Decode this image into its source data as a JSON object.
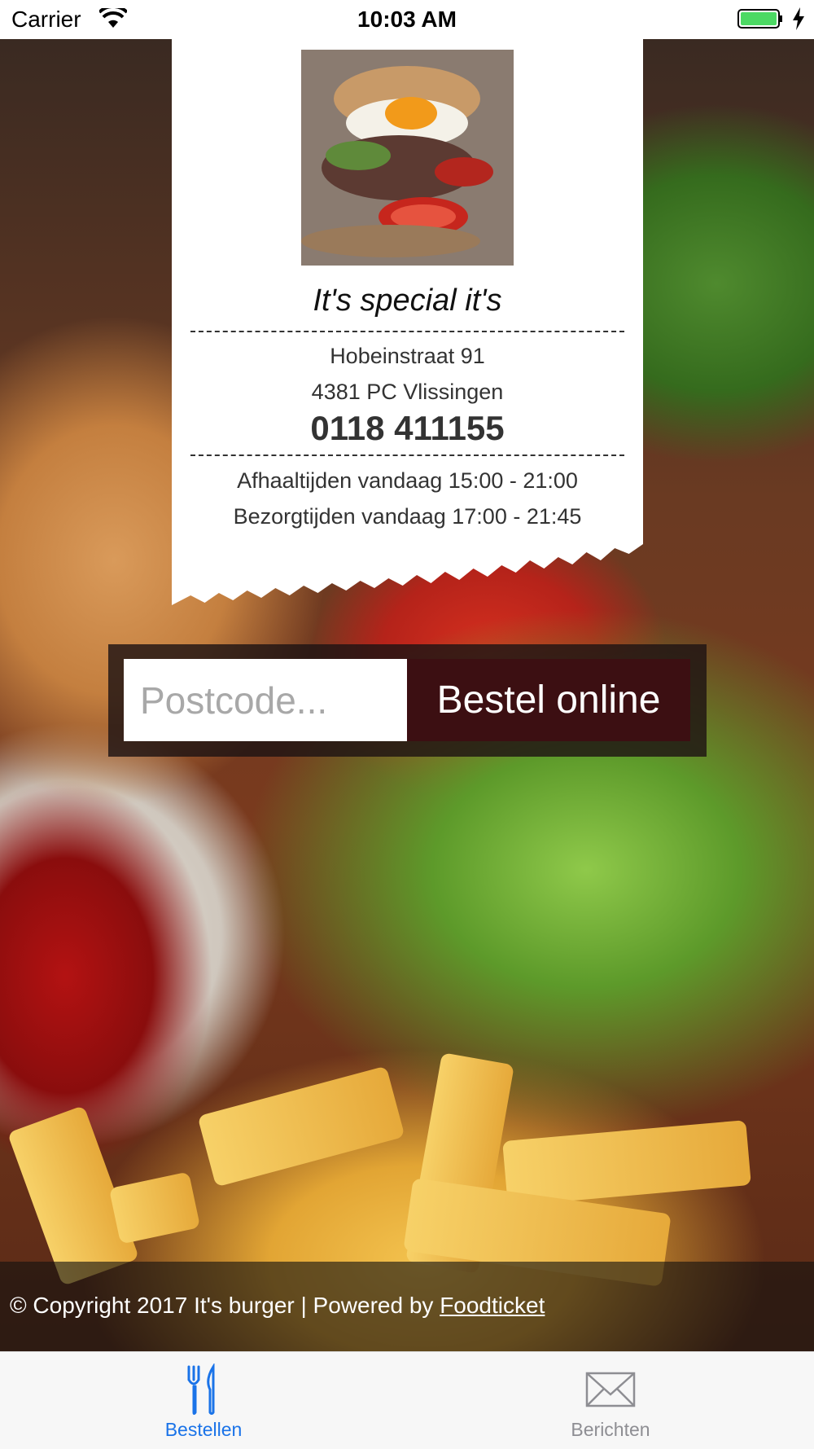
{
  "status_bar": {
    "carrier": "Carrier",
    "time": "10:03 AM",
    "battery_color": "#4cd964"
  },
  "restaurant": {
    "name": "It's special it's",
    "street": "Hobeinstraat 91",
    "city": "4381 PC Vlissingen",
    "phone": "0118 411155",
    "pickup_times": "Afhaaltijden vandaag 15:00 - 21:00",
    "delivery_times": "Bezorgtijden vandaag 17:00 - 21:45"
  },
  "order": {
    "postcode_placeholder": "Postcode...",
    "postcode_value": "",
    "button_label": "Bestel online",
    "button_color": "#3c0f12"
  },
  "footer": {
    "copyright": "© Copyright 2017 It's burger | Powered by ",
    "link_label": "Foodticket"
  },
  "tabs": [
    {
      "label": "Bestellen",
      "icon": "fork-knife-icon",
      "active": true,
      "color": "#1a73e8"
    },
    {
      "label": "Berichten",
      "icon": "envelope-icon",
      "active": false,
      "color": "#8e8e93"
    }
  ]
}
